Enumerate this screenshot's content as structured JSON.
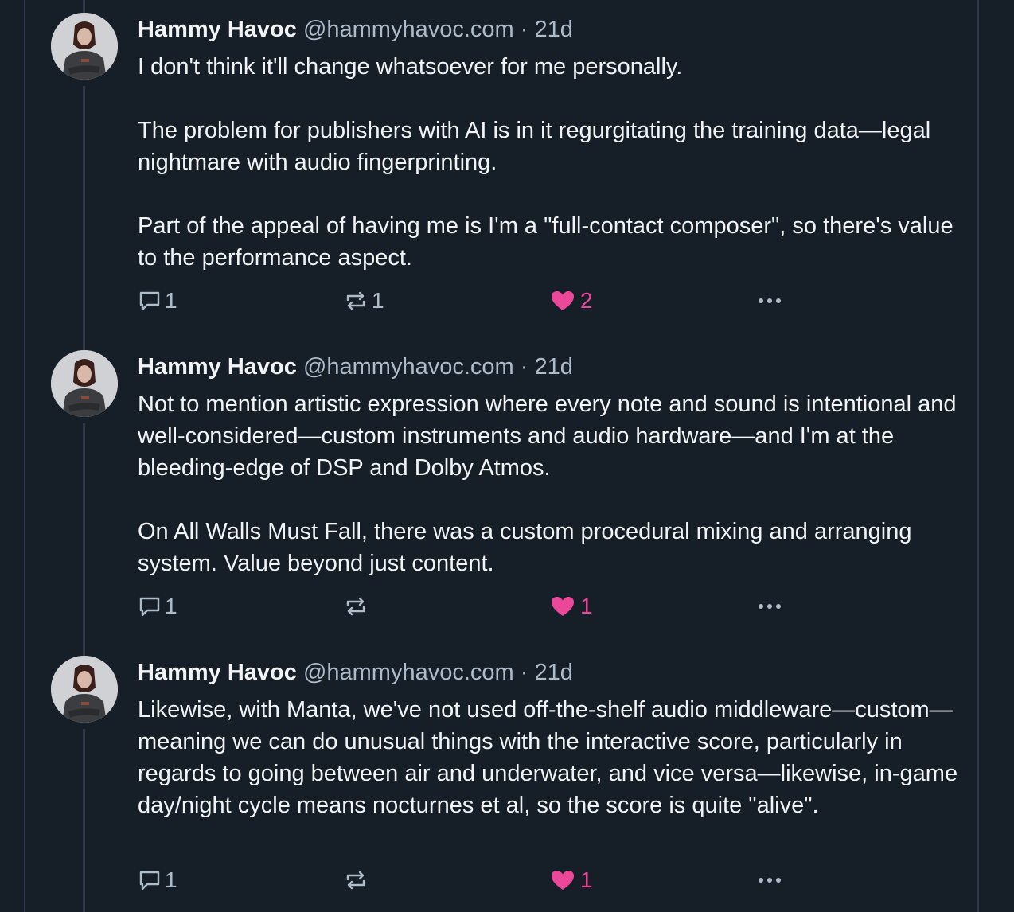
{
  "colors": {
    "background": "#161e27",
    "text": "#f1f3f5",
    "muted": "#aebbc9",
    "like": "#ec4899",
    "thread_line": "#2e3a47"
  },
  "posts": [
    {
      "author": "Hammy Havoc",
      "handle": "@hammyhavoc.com",
      "separator": "·",
      "time": "21d",
      "paragraphs": [
        "I don't think it'll change whatsoever for me personally.",
        "The problem for publishers with AI is in it regurgitating the training data—legal nightmare with audio fingerprinting.",
        "Part of the appeal of having me is I'm a \"full-contact composer\", so there's value to the performance aspect."
      ],
      "replies": "1",
      "reposts": "1",
      "likes": "2",
      "liked": true
    },
    {
      "author": "Hammy Havoc",
      "handle": "@hammyhavoc.com",
      "separator": "·",
      "time": "21d",
      "paragraphs": [
        "Not to mention artistic expression where every note and sound is intentional and well-considered—custom instruments and audio hardware—and I'm at the bleeding-edge of DSP and Dolby Atmos.",
        "On All Walls Must Fall, there was a custom procedural mixing and arranging system. Value beyond just content."
      ],
      "replies": "1",
      "reposts": "",
      "likes": "1",
      "liked": true
    },
    {
      "author": "Hammy Havoc",
      "handle": "@hammyhavoc.com",
      "separator": "·",
      "time": "21d",
      "paragraphs": [
        "Likewise, with Manta, we've not used off-the-shelf audio middleware—custom—meaning we can do unusual things with the interactive score, particularly in regards to going between air and underwater, and vice versa—likewise, in-game day/night cycle means nocturnes et al, so the score is quite \"alive\"."
      ],
      "replies": "1",
      "reposts": "",
      "likes": "1",
      "liked": true
    }
  ],
  "icons": {
    "reply": "speech-bubble-icon",
    "repost": "repost-arrows-icon",
    "like": "heart-icon",
    "more": "ellipsis-icon"
  }
}
